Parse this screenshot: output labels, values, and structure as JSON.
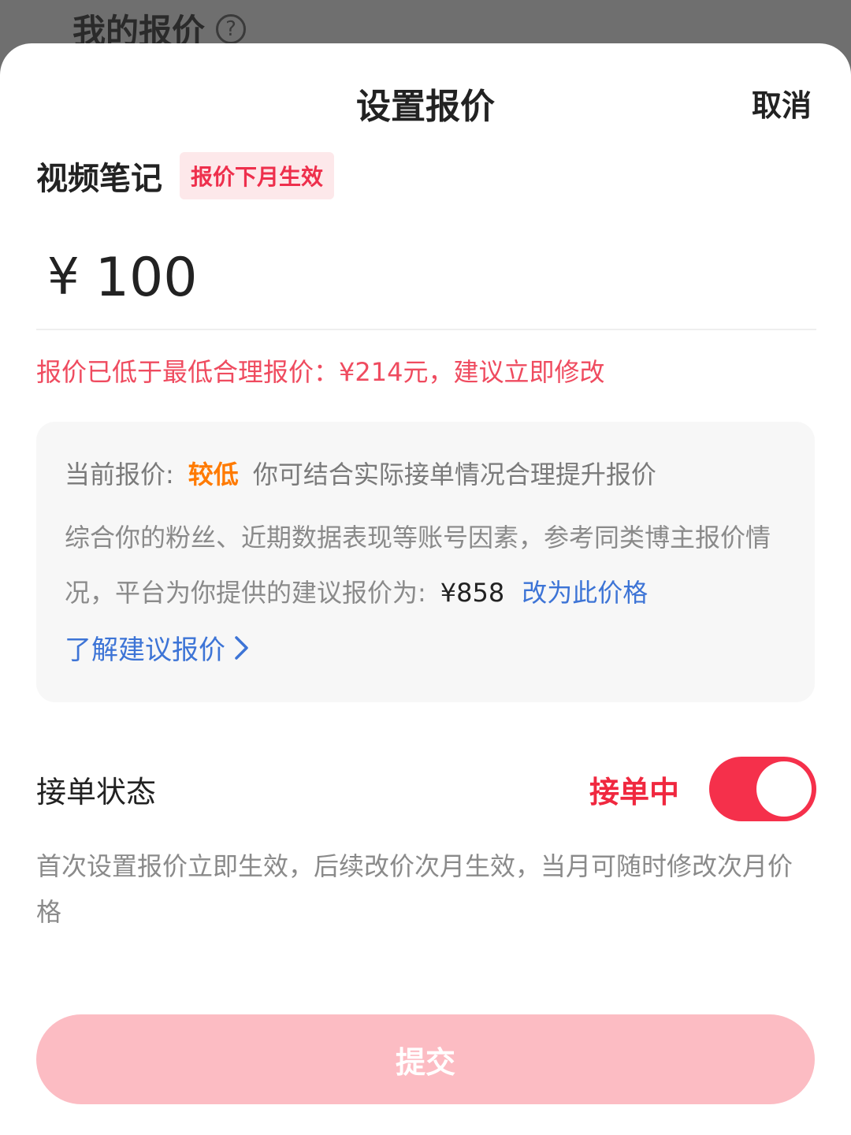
{
  "background": {
    "title": "我的报价",
    "help_icon": "?"
  },
  "sheet": {
    "title": "设置报价",
    "cancel_label": "取消",
    "note_type": "视频笔记",
    "badge": "报价下月生效",
    "price_symbol": "¥",
    "price_value": "100",
    "warning": "报价已低于最低合理报价：¥214元，建议立即修改"
  },
  "info": {
    "current_label": "当前报价:",
    "current_level": "较低",
    "current_hint": "你可结合实际接单情况合理提升报价",
    "desc": "综合你的粉丝、近期数据表现等账号因素，参考同类博主报价情况，平台为你提供的建议报价为:",
    "suggested_price": "¥858",
    "change_label": "改为此价格",
    "learn_label": "了解建议报价"
  },
  "status": {
    "label": "接单状态",
    "value": "接单中",
    "toggle_on": true
  },
  "note": "首次设置报价立即生效，后续改价次月生效，当月可随时修改次月价格",
  "submit_label": "提交",
  "colors": {
    "accent": "#f5304b",
    "link": "#3d74d6",
    "warning": "#ef4b5f",
    "level": "#ff7a00",
    "submit_disabled": "#fcbcc3"
  }
}
